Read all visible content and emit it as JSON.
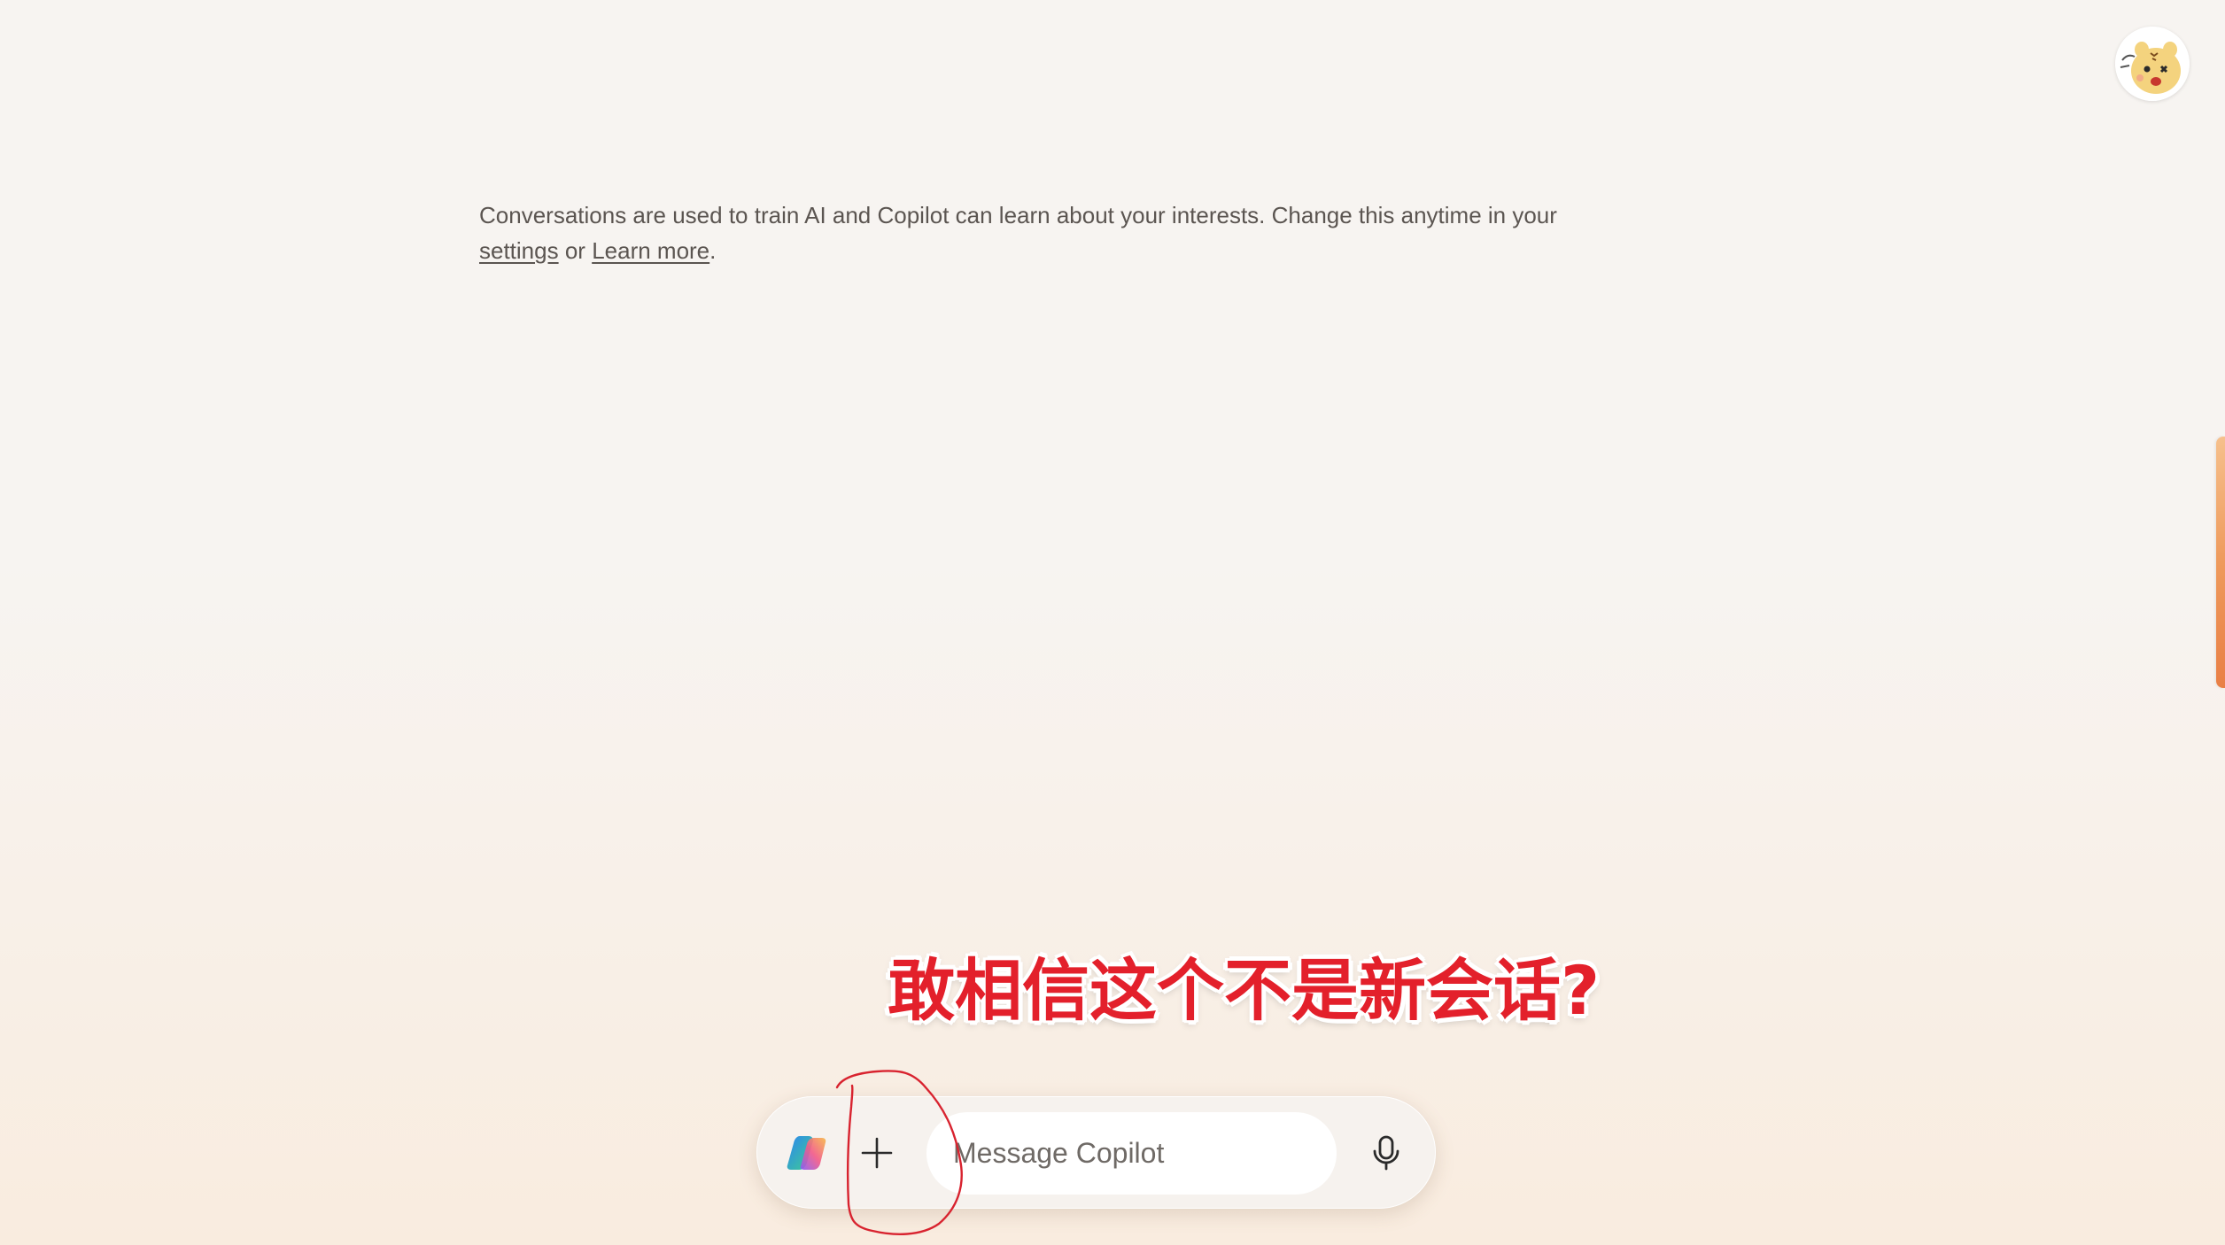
{
  "notice": {
    "line1": "Conversations are used to train AI and Copilot can learn about your interests. Change this anytime in your",
    "settings_link": "settings",
    "middle": " or ",
    "learn_more_link": "Learn more",
    "end": "."
  },
  "composer": {
    "placeholder": "Message Copilot",
    "value": ""
  },
  "annotation": {
    "caption": "敢相信这个不是新会话?"
  },
  "icons": {
    "avatar": "user-avatar",
    "copilot": "copilot-logo-icon",
    "plus": "plus-icon",
    "mic": "microphone-icon"
  },
  "colors": {
    "bg-top": "#f7f4f1",
    "bg-bottom": "#f9ecdf",
    "annotation-red": "#e3202b",
    "accent-orange": "#ee9a5c"
  }
}
